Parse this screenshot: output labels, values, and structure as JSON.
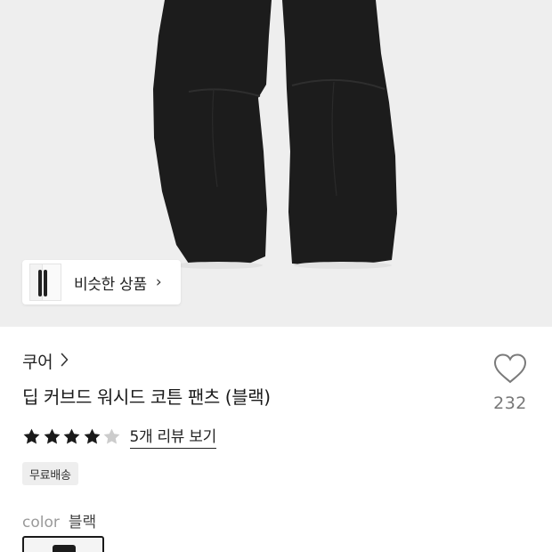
{
  "similar_button": {
    "label": "비슷한 상품",
    "chevron": "›"
  },
  "product": {
    "brand": "쿠어",
    "title": "딥 커브드 워시드 코튼 팬츠 (블랙)",
    "like_count": "232",
    "rating": {
      "stars_filled": 4,
      "stars_total": 5
    },
    "review_link": "5개 리뷰 보기",
    "shipping_badge": "무료배송",
    "option": {
      "label": "color",
      "value": "블랙"
    }
  },
  "colors": {
    "star_filled": "#1a1a1a",
    "star_empty": "#cccccc",
    "hero_bg": "#eeeeee",
    "pants": "#1a1a1a"
  },
  "icons": {
    "like": "heart-outline-icon",
    "brand_chevron": "chevron-right-icon"
  }
}
